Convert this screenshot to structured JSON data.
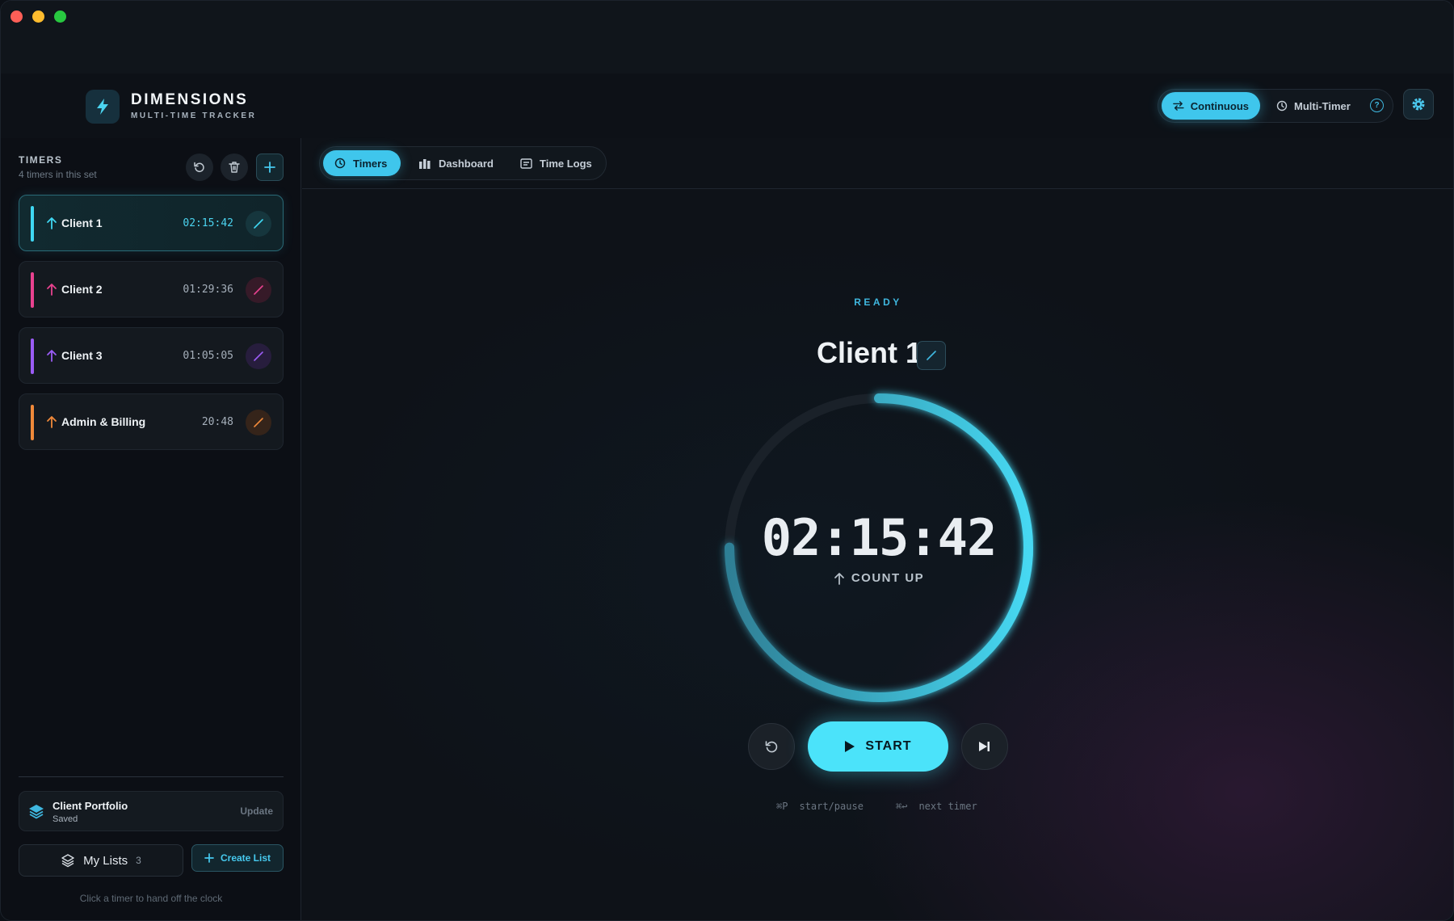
{
  "header": {
    "brand_title": "DIMENSIONS",
    "brand_subtitle": "MULTI-TIME TRACKER",
    "modes": [
      {
        "label": "Continuous",
        "active": true
      },
      {
        "label": "Multi-Timer",
        "active": false
      }
    ],
    "help_label": "?"
  },
  "sidebar": {
    "title": "TIMERS",
    "subtitle": "4 timers in this set",
    "timers": [
      {
        "name": "Client 1",
        "time": "02:15:42",
        "color": "#3fd7f2",
        "active": true
      },
      {
        "name": "Client 2",
        "time": "01:29:36",
        "color": "#e8428f",
        "active": false
      },
      {
        "name": "Client 3",
        "time": "01:05:05",
        "color": "#9b5cf5",
        "active": false
      },
      {
        "name": "Admin & Billing",
        "time": "20:48",
        "color": "#f0893a",
        "active": false
      }
    ],
    "portfolio": {
      "name": "Client Portfolio",
      "status": "Saved",
      "action": "Update"
    },
    "my_lists": {
      "label": "My Lists",
      "count": "3"
    },
    "create_list": "Create List",
    "hint": "Click a timer to hand off the clock"
  },
  "tabs": [
    {
      "label": "Timers",
      "active": true
    },
    {
      "label": "Dashboard",
      "active": false
    },
    {
      "label": "Time Logs",
      "active": false
    }
  ],
  "main": {
    "status": "READY",
    "client": "Client 1",
    "time": "02:15:42",
    "count_mode": "COUNT UP",
    "progress": 0.75,
    "start_label": "START",
    "shortcuts": [
      {
        "keys": "⌘P",
        "label": "start/pause"
      },
      {
        "keys": "⌘↩",
        "label": "next timer"
      }
    ]
  },
  "colors": {
    "accent": "#3fc6ec",
    "start": "#4be3fa"
  }
}
